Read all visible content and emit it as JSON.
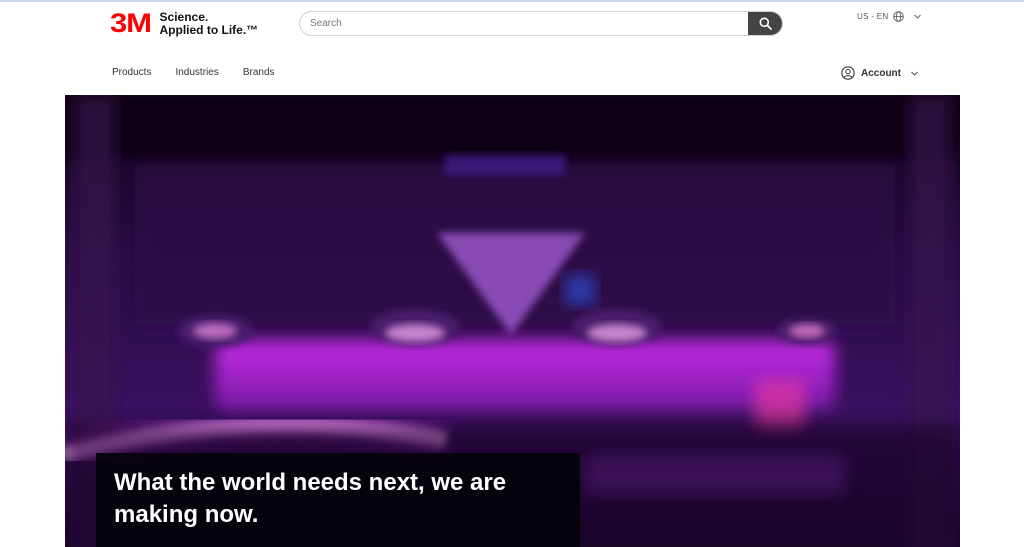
{
  "brand": {
    "logo_text": "3M",
    "tagline_line1": "Science.",
    "tagline_line2": "Applied to Life.™",
    "logo_color": "#ff0000"
  },
  "search": {
    "placeholder": "Search",
    "icon": "search-icon"
  },
  "locale": {
    "label": "US - EN",
    "icon": "globe-icon"
  },
  "nav": {
    "items": [
      "Products",
      "Industries",
      "Brands"
    ]
  },
  "account": {
    "label": "Account",
    "icon": "user-circle-icon"
  },
  "hero": {
    "headline": "What the world needs next, we are making now.",
    "accent_color": "#b21bd8"
  }
}
